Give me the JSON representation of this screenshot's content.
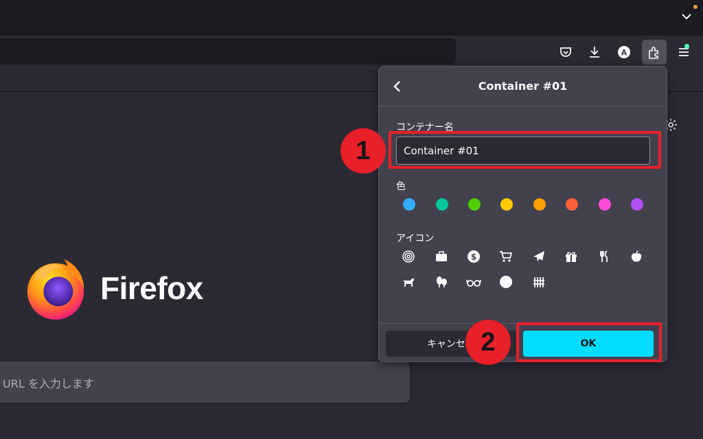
{
  "panel": {
    "title": "Container #01",
    "name_label": "コンテナー名",
    "name_value": "Container #01",
    "color_label": "色",
    "icon_label": "アイコン",
    "cancel_label": "キャンセル",
    "ok_label": "OK"
  },
  "colors": [
    {
      "name": "blue",
      "hex": "#37adff"
    },
    {
      "name": "turquoise",
      "hex": "#00c79a"
    },
    {
      "name": "green",
      "hex": "#51cd00"
    },
    {
      "name": "yellow",
      "hex": "#ffcb00"
    },
    {
      "name": "orange",
      "hex": "#ff9f00"
    },
    {
      "name": "red",
      "hex": "#ff613d"
    },
    {
      "name": "pink",
      "hex": "#ff4bda"
    },
    {
      "name": "purple",
      "hex": "#af51f5"
    }
  ],
  "icons": [
    "fingerprint-icon",
    "briefcase-icon",
    "dollar-icon",
    "cart-icon",
    "vacation-icon",
    "gift-icon",
    "food-icon",
    "fruit-icon",
    "pet-icon",
    "tree-icon",
    "chill-icon",
    "circle-icon",
    "fence-icon"
  ],
  "home": {
    "brand": "Firefox",
    "search_placeholder": "URL を入力します"
  },
  "annotations": {
    "step1": "1",
    "step2": "2",
    "highlight_color": "#e8202a"
  }
}
